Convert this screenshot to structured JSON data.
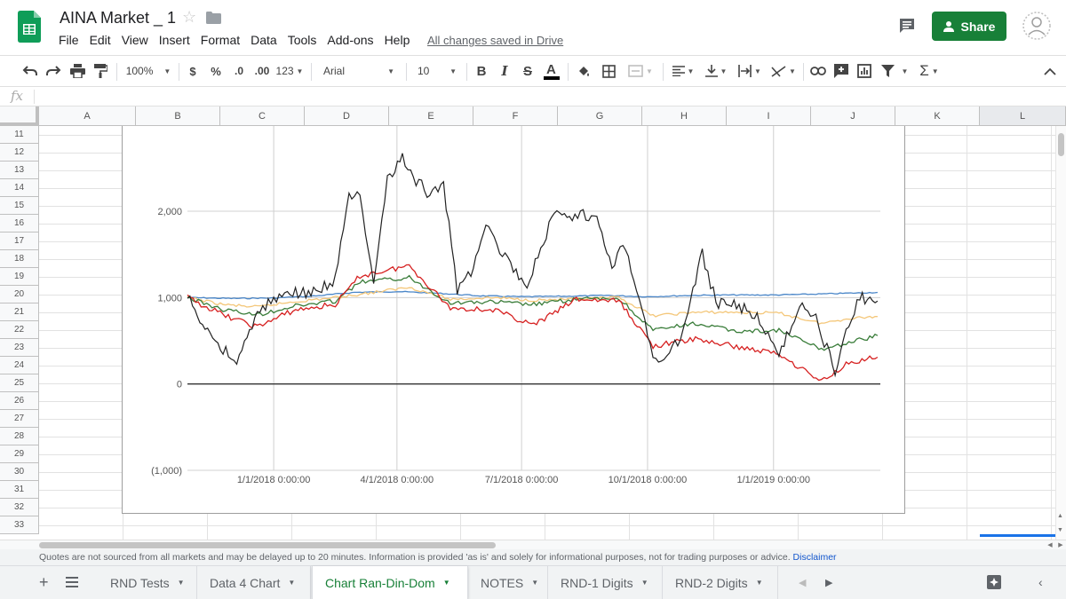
{
  "app": {
    "title": "AINA Market _ 1",
    "menu": [
      "File",
      "Edit",
      "View",
      "Insert",
      "Format",
      "Data",
      "Tools",
      "Add-ons",
      "Help"
    ],
    "saved_status": "All changes saved in Drive",
    "share_label": "Share",
    "brand_color": "#188038"
  },
  "toolbar": {
    "zoom": "100%",
    "currency": "$",
    "percent": "%",
    "dec_less": ".0",
    "dec_more": ".00",
    "more_formats": "123",
    "font": "Arial",
    "font_size": "10"
  },
  "formula_bar": {
    "label": "fx",
    "value": ""
  },
  "grid": {
    "columns": [
      "A",
      "B",
      "C",
      "D",
      "E",
      "F",
      "G",
      "H",
      "I",
      "J",
      "K",
      "L"
    ],
    "rows": [
      "11",
      "12",
      "13",
      "14",
      "15",
      "16",
      "17",
      "18",
      "19",
      "20",
      "21",
      "22",
      "23",
      "24",
      "25",
      "26",
      "27",
      "28",
      "29",
      "30",
      "31",
      "32",
      "33"
    ],
    "selected_column": "L"
  },
  "chart_data": {
    "type": "line",
    "title": "",
    "xlabel": "",
    "ylabel": "",
    "ylim": [
      -1000,
      2000
    ],
    "yticks": [
      "(1,000)",
      "0",
      "1,000",
      "2,000"
    ],
    "xticks": [
      "1/1/2018 0:00:00",
      "4/1/2018 0:00:00",
      "7/1/2018 0:00:00",
      "10/1/2018 0:00:00",
      "1/1/2019 0:00:00"
    ],
    "xtick_dates": [
      "2018-01-01",
      "2018-04-01",
      "2018-07-01",
      "2018-10-01",
      "2019-01-01"
    ],
    "x_range": [
      "2017-10-30",
      "2019-03-20"
    ],
    "grid": true,
    "legend": "none",
    "series": [
      {
        "color": "#4a86c8",
        "x": [
          "2017-10-30",
          "2017-12-01",
          "2018-01-01",
          "2018-02-01",
          "2018-03-01",
          "2018-04-01",
          "2018-05-01",
          "2018-06-01",
          "2018-07-01",
          "2018-08-01",
          "2018-09-01",
          "2018-10-01",
          "2018-11-01",
          "2018-12-01",
          "2019-01-01",
          "2019-02-01",
          "2019-03-18"
        ],
        "y": [
          1000,
          990,
          995,
          1020,
          1060,
          1070,
          1050,
          1020,
          1010,
          1015,
          1025,
          1010,
          1025,
          1030,
          1030,
          1040,
          1060
        ]
      },
      {
        "color": "#f4c77a",
        "x": [
          "2017-10-30",
          "2017-11-25",
          "2017-12-20",
          "2018-01-15",
          "2018-02-15",
          "2018-03-15",
          "2018-04-10",
          "2018-05-10",
          "2018-06-10",
          "2018-07-10",
          "2018-08-10",
          "2018-09-10",
          "2018-10-05",
          "2018-11-05",
          "2018-12-05",
          "2019-01-05",
          "2019-02-05",
          "2019-02-25",
          "2019-03-18"
        ],
        "y": [
          1000,
          920,
          890,
          950,
          1000,
          1060,
          1120,
          980,
          1000,
          970,
          980,
          1000,
          790,
          830,
          830,
          820,
          700,
          760,
          780
        ]
      },
      {
        "color": "#3a7d3a",
        "x": [
          "2017-10-30",
          "2017-11-25",
          "2017-12-20",
          "2018-01-15",
          "2018-02-15",
          "2018-03-05",
          "2018-04-10",
          "2018-05-10",
          "2018-06-10",
          "2018-07-10",
          "2018-08-10",
          "2018-09-10",
          "2018-10-05",
          "2018-11-05",
          "2018-12-05",
          "2019-01-05",
          "2019-02-05",
          "2019-02-25",
          "2019-03-18"
        ],
        "y": [
          1000,
          860,
          800,
          900,
          960,
          1180,
          1230,
          940,
          950,
          920,
          980,
          990,
          620,
          700,
          610,
          620,
          400,
          480,
          560
        ]
      },
      {
        "color": "#d62020",
        "x": [
          "2017-10-30",
          "2017-11-25",
          "2017-12-20",
          "2018-01-15",
          "2018-02-15",
          "2018-03-05",
          "2018-04-10",
          "2018-05-10",
          "2018-06-10",
          "2018-07-10",
          "2018-08-10",
          "2018-09-10",
          "2018-10-05",
          "2018-11-05",
          "2018-12-05",
          "2019-01-05",
          "2019-02-05",
          "2019-02-25",
          "2019-03-18"
        ],
        "y": [
          1000,
          800,
          660,
          850,
          920,
          1250,
          1370,
          880,
          860,
          680,
          980,
          960,
          440,
          520,
          430,
          350,
          30,
          250,
          310
        ]
      },
      {
        "color": "#222222",
        "x": [
          "2017-10-30",
          "2017-11-10",
          "2017-11-25",
          "2017-12-05",
          "2017-12-20",
          "2018-01-01",
          "2018-01-15",
          "2018-02-01",
          "2018-02-15",
          "2018-02-25",
          "2018-03-05",
          "2018-03-15",
          "2018-03-25",
          "2018-04-05",
          "2018-04-15",
          "2018-04-25",
          "2018-05-05",
          "2018-05-15",
          "2018-05-25",
          "2018-06-05",
          "2018-06-15",
          "2018-06-25",
          "2018-07-05",
          "2018-07-15",
          "2018-07-25",
          "2018-08-05",
          "2018-08-15",
          "2018-08-25",
          "2018-09-05",
          "2018-09-15",
          "2018-09-25",
          "2018-10-05",
          "2018-10-15",
          "2018-10-25",
          "2018-11-05",
          "2018-11-10",
          "2018-11-20",
          "2018-12-05",
          "2018-12-20",
          "2019-01-05",
          "2019-01-20",
          "2019-02-01",
          "2019-02-15",
          "2019-02-25",
          "2019-03-05",
          "2019-03-18"
        ],
        "y": [
          1000,
          700,
          400,
          260,
          800,
          1000,
          1050,
          1060,
          1200,
          2200,
          2150,
          1100,
          2400,
          2600,
          2350,
          2200,
          2300,
          1100,
          1300,
          1900,
          1550,
          1350,
          1050,
          1600,
          1950,
          1900,
          1950,
          1900,
          1400,
          1600,
          1000,
          300,
          280,
          550,
          1200,
          1500,
          950,
          900,
          800,
          300,
          950,
          750,
          150,
          700,
          1000,
          960
        ]
      }
    ]
  },
  "disclaimer": {
    "text": "Quotes are not sourced from all markets and may be delayed up to 20 minutes. Information is provided 'as is' and solely for informational purposes, not for trading purposes or advice.",
    "link": "Disclaimer"
  },
  "sheets": {
    "tabs": [
      "RND Tests",
      "Data 4 Chart",
      "Chart Ran-Din-Dom",
      "NOTES",
      "RND-1 Digits",
      "RND-2 Digits"
    ],
    "active": "Chart Ran-Din-Dom"
  }
}
